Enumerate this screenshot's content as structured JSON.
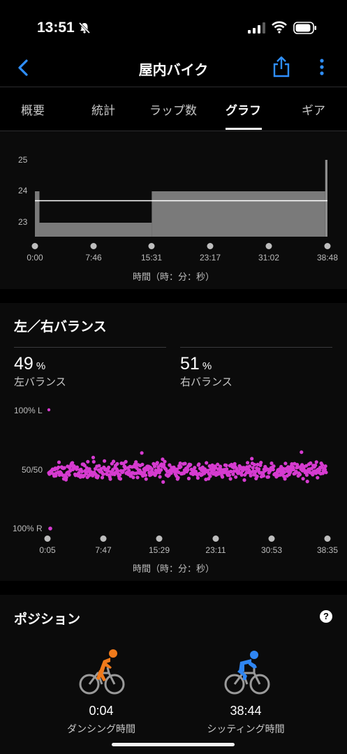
{
  "status": {
    "time": "13:51"
  },
  "nav": {
    "title": "屋内バイク"
  },
  "tabs": [
    "概要",
    "統計",
    "ラップ数",
    "グラフ",
    "ギア"
  ],
  "colors": {
    "accent": "#2f8fff",
    "balance_dots": "#d63bd0",
    "standing": "#f07a1b",
    "seated": "#2f86f3"
  },
  "upper_chart": {
    "axis_title": "時間（時：分：秒）",
    "chart_data": {
      "type": "area",
      "y_ticks": [
        "25",
        "24",
        "23"
      ],
      "ylim": [
        22.5,
        25.5
      ],
      "x_ticks": [
        "0:00",
        "7:46",
        "15:31",
        "23:17",
        "31:02",
        "38:48"
      ],
      "xlim_minutes": [
        0,
        38.8
      ],
      "steps": [
        {
          "from": 0,
          "to": 0.6,
          "value": 24
        },
        {
          "from": 0.6,
          "to": 15.5,
          "value": 23
        },
        {
          "from": 15.5,
          "to": 38.5,
          "value": 24
        },
        {
          "from": 38.5,
          "to": 38.8,
          "value": 25
        }
      ],
      "average": 23.7
    }
  },
  "balance": {
    "title": "左／右バランス",
    "left": {
      "value": "49",
      "unit": "%",
      "label": "左バランス"
    },
    "right": {
      "value": "51",
      "unit": "%",
      "label": "右バランス"
    },
    "axis_title": "時間（時：分：秒）",
    "chart_data": {
      "type": "scatter",
      "y_labels": [
        "100% L",
        "50/50",
        "100% R"
      ],
      "ylim_percent_left": [
        0,
        100
      ],
      "x_ticks": [
        "0:05",
        "7:47",
        "15:29",
        "23:11",
        "30:53",
        "38:35"
      ],
      "center_percent_left": 49,
      "spread": 3
    }
  },
  "position": {
    "title": "ポジション",
    "help": "?",
    "standing": {
      "value": "0:04",
      "label": "ダンシング時間"
    },
    "seated": {
      "value": "38:44",
      "label": "シッティング時間"
    }
  }
}
